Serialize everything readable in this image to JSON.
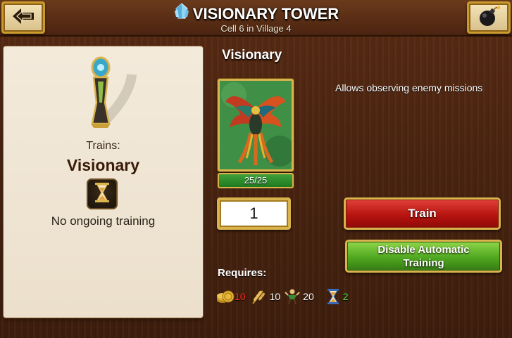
{
  "header": {
    "title": "VISIONARY TOWER",
    "subtitle": "Cell 6 in Village 4",
    "back_icon": "back-arrow-icon",
    "bomb_icon": "bomb-icon",
    "crystal_icon": "crystal-icon"
  },
  "left_panel": {
    "trains_label": "Trains:",
    "unit_name": "Visionary",
    "status": "No ongoing training"
  },
  "unit": {
    "title": "Visionary",
    "description": "Allows observing enemy missions",
    "count": "25/25"
  },
  "training": {
    "quantity": "1",
    "train_label": "Train",
    "auto_line1": "Disable Automatic",
    "auto_line2": "Training"
  },
  "requires": {
    "label": "Requires:",
    "items": [
      {
        "icon": "gold-coins-icon",
        "value": "10",
        "color": "#ff2a1a"
      },
      {
        "icon": "wheat-icon",
        "value": "10",
        "color": "#ffffff"
      },
      {
        "icon": "population-icon",
        "value": "20",
        "color": "#ffffff"
      },
      {
        "icon": "hourglass-icon",
        "value": "2",
        "color": "#4ee24a"
      }
    ]
  }
}
